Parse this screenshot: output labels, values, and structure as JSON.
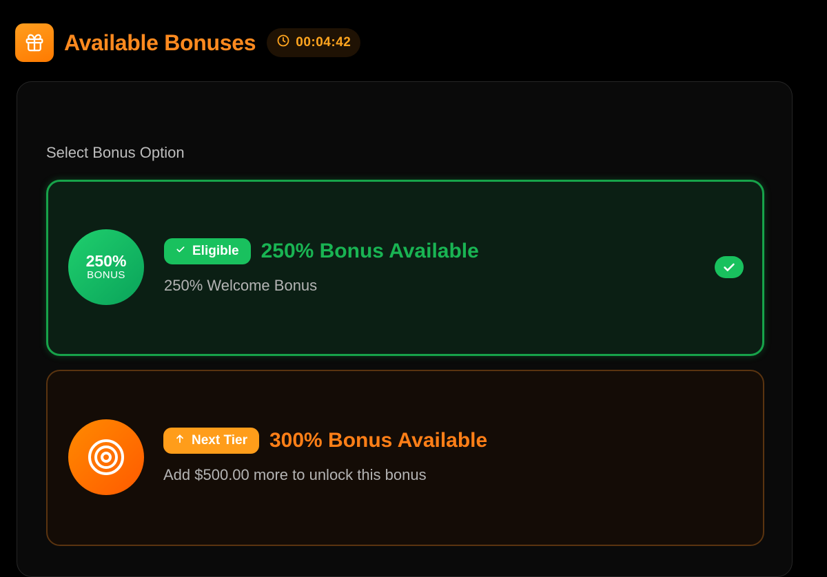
{
  "header": {
    "title": "Available Bonuses",
    "timer": "00:04:42",
    "icon": "gift-icon",
    "timer_icon": "clock-icon"
  },
  "panel": {
    "section_label": "Select Bonus Option",
    "options": [
      {
        "circle_big": "250%",
        "circle_small": "BONUS",
        "badge_label": "Eligible",
        "badge_icon": "check-icon",
        "headline": "250% Bonus Available",
        "description": "250% Welcome Bonus",
        "selected": true,
        "color": "#19c15e"
      },
      {
        "circle_icon": "target-icon",
        "badge_label": "Next Tier",
        "badge_icon": "arrow-up-icon",
        "headline": "300% Bonus Available",
        "description": "Add $500.00 more to unlock this bonus",
        "selected": false,
        "color": "#ff9d1a"
      }
    ]
  },
  "colors": {
    "accent_orange": "#ff8a1f",
    "success_green": "#19c15e",
    "background": "#000000"
  }
}
